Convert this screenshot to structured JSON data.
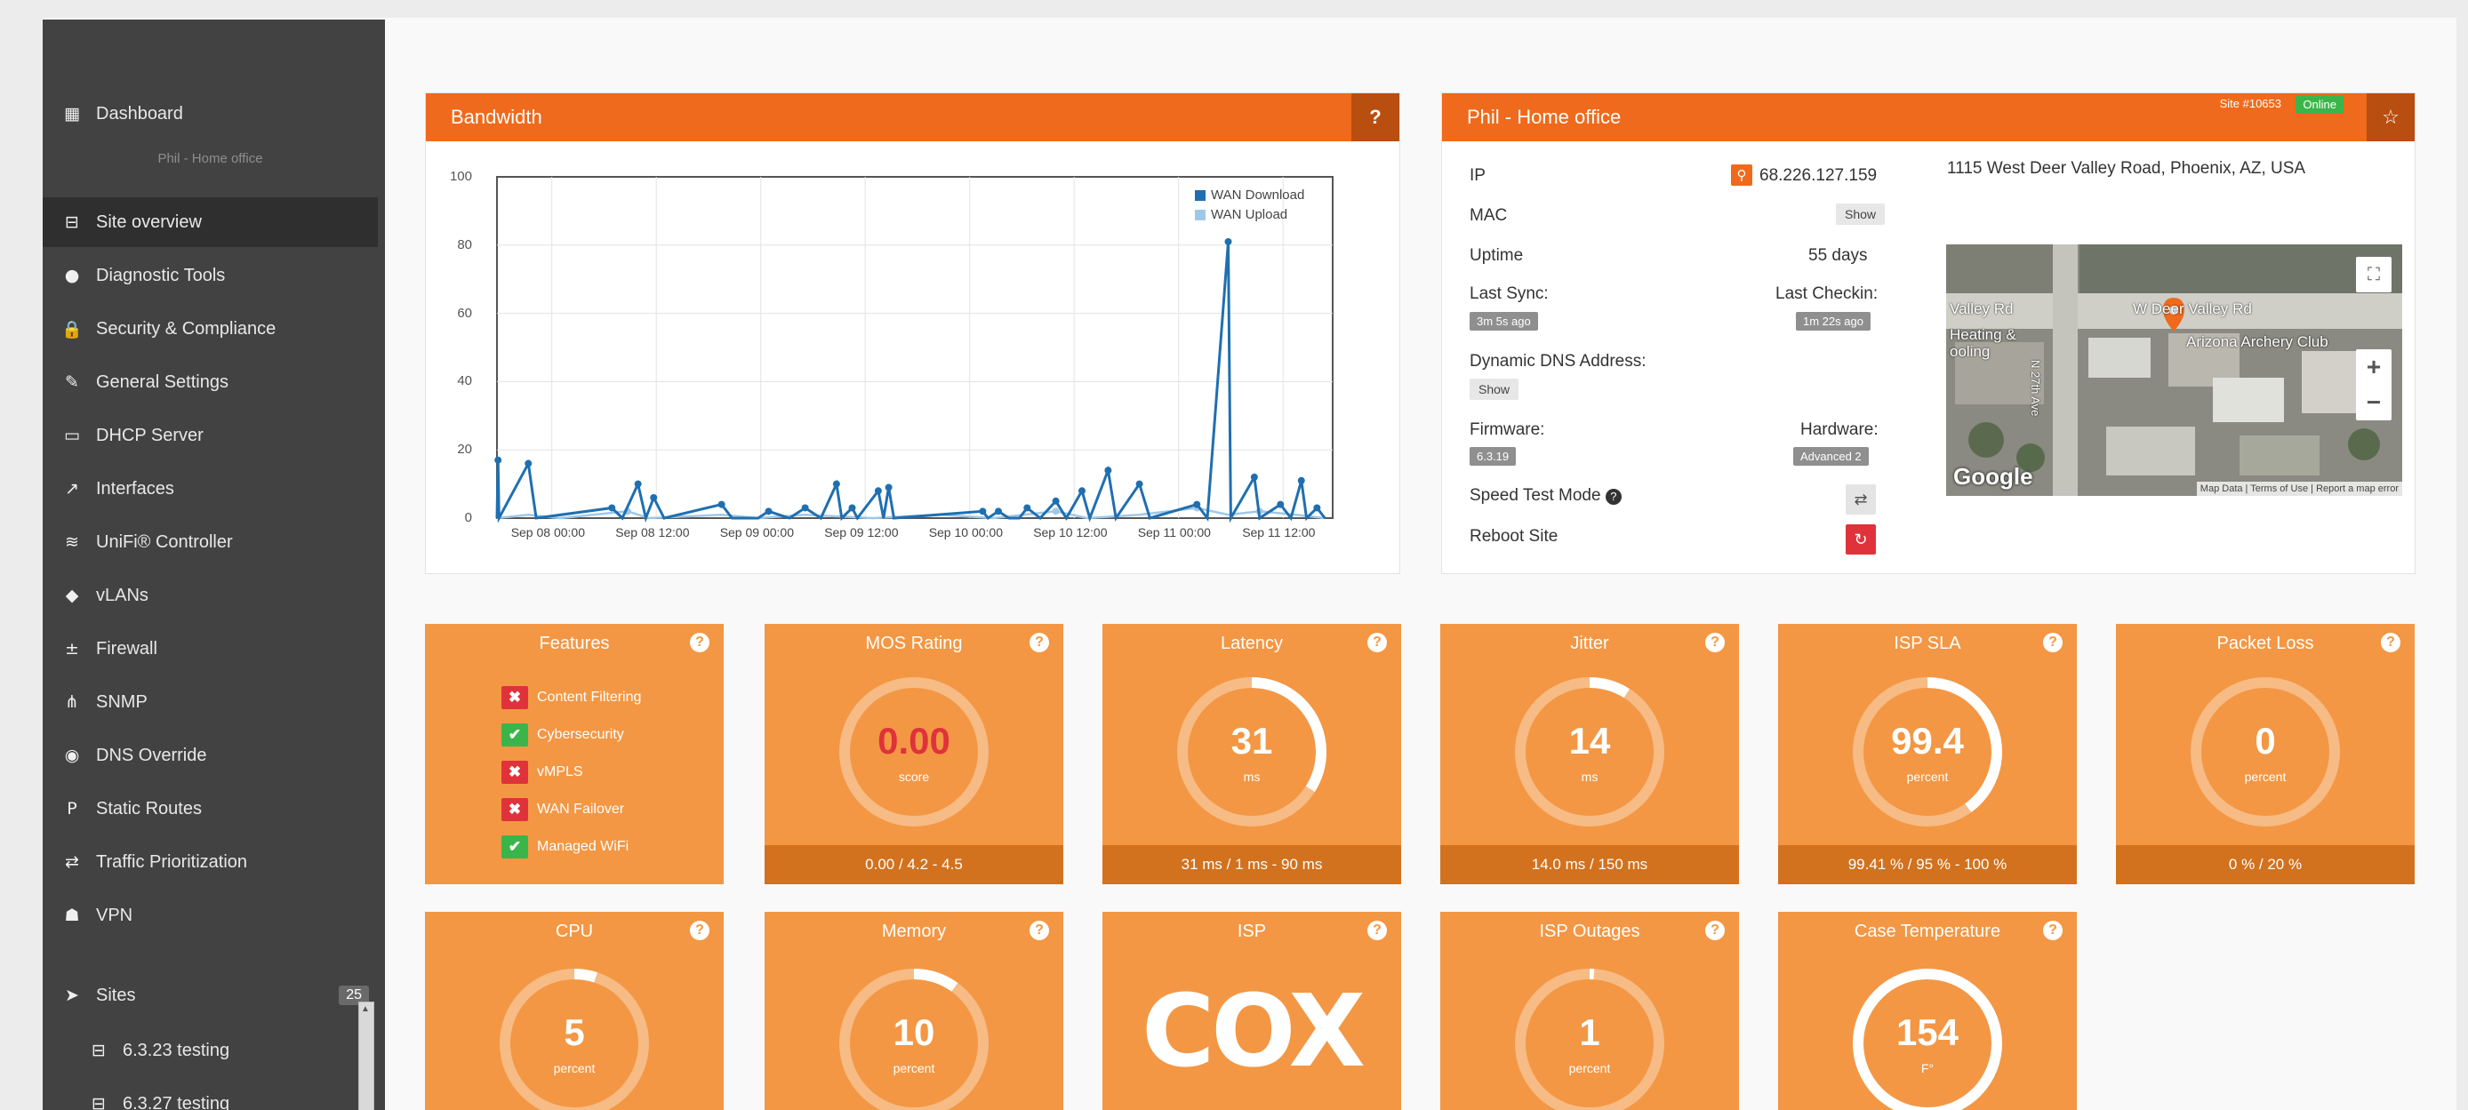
{
  "sidebar": {
    "dashboard": "Dashboard",
    "site_caption": "Phil - Home office",
    "items": [
      {
        "label": "Site overview",
        "icon": "site-overview-icon",
        "glyph": "⊟"
      },
      {
        "label": "Diagnostic Tools",
        "icon": "info-icon",
        "glyph": "●"
      },
      {
        "label": "Security & Compliance",
        "icon": "lock-icon",
        "glyph": "🔒"
      },
      {
        "label": "General Settings",
        "icon": "wrench-icon",
        "glyph": "✎"
      },
      {
        "label": "DHCP Server",
        "icon": "monitor-icon",
        "glyph": "▭"
      },
      {
        "label": "Interfaces",
        "icon": "external-link-icon",
        "glyph": "↗"
      },
      {
        "label": "UniFi® Controller",
        "icon": "antenna-icon",
        "glyph": "≋"
      },
      {
        "label": "vLANs",
        "icon": "tag-icon",
        "glyph": "◆"
      },
      {
        "label": "Firewall",
        "icon": "firewall-icon",
        "glyph": "±"
      },
      {
        "label": "SNMP",
        "icon": "sitemap-icon",
        "glyph": "⋔"
      },
      {
        "label": "DNS Override",
        "icon": "dns-icon",
        "glyph": "◉"
      },
      {
        "label": "Static Routes",
        "icon": "route-icon",
        "glyph": "P"
      },
      {
        "label": "Traffic Prioritization",
        "icon": "exchange-icon",
        "glyph": "⇄"
      },
      {
        "label": "VPN",
        "icon": "users-icon",
        "glyph": "☗"
      }
    ],
    "sites_label": "Sites",
    "sites_count": "25",
    "sites": [
      "6.3.23 testing",
      "6.3.27 testing"
    ]
  },
  "bandwidth": {
    "title": "Bandwidth",
    "help": "?",
    "legend": [
      {
        "label": "WAN Download",
        "color": "#1f6fb0"
      },
      {
        "label": "WAN Upload",
        "color": "#9fc8e8"
      }
    ]
  },
  "chart_data": {
    "type": "line",
    "ylim": [
      0,
      100
    ],
    "yticks": [
      "100",
      "80",
      "60",
      "40",
      "20",
      "0"
    ],
    "categories": [
      "Sep 08 00:00",
      "Sep 08 12:00",
      "Sep 09 00:00",
      "Sep 09 12:00",
      "Sep 10 00:00",
      "Sep 10 12:00",
      "Sep 11 00:00",
      "Sep 11 12:00"
    ],
    "series": [
      {
        "name": "WAN Download",
        "color": "#1f6fb0",
        "points": [
          [
            0,
            0
          ],
          [
            0.02,
            17
          ],
          [
            0.04,
            0
          ],
          [
            0.6,
            16
          ],
          [
            0.75,
            0
          ],
          [
            2.2,
            3
          ],
          [
            2.4,
            0
          ],
          [
            2.7,
            10
          ],
          [
            2.85,
            0
          ],
          [
            3.0,
            6
          ],
          [
            3.2,
            0
          ],
          [
            4.3,
            4
          ],
          [
            4.5,
            0
          ],
          [
            5.0,
            0
          ],
          [
            5.2,
            2
          ],
          [
            5.6,
            0
          ],
          [
            5.9,
            3
          ],
          [
            6.2,
            0
          ],
          [
            6.5,
            10
          ],
          [
            6.6,
            0
          ],
          [
            6.8,
            3
          ],
          [
            6.9,
            0
          ],
          [
            7.3,
            8
          ],
          [
            7.4,
            0
          ],
          [
            7.5,
            9
          ],
          [
            7.6,
            0
          ],
          [
            9.3,
            2
          ],
          [
            9.4,
            0
          ],
          [
            9.6,
            2
          ],
          [
            9.8,
            0
          ],
          [
            10.0,
            0
          ],
          [
            10.15,
            3
          ],
          [
            10.4,
            0
          ],
          [
            10.7,
            5
          ],
          [
            10.9,
            0
          ],
          [
            11.2,
            8
          ],
          [
            11.35,
            0
          ],
          [
            11.7,
            14
          ],
          [
            11.85,
            0
          ],
          [
            12.3,
            10
          ],
          [
            12.5,
            0
          ],
          [
            13.4,
            4
          ],
          [
            13.6,
            0
          ],
          [
            14.0,
            81
          ],
          [
            14.05,
            0
          ],
          [
            14.5,
            12
          ],
          [
            14.6,
            0
          ],
          [
            15.0,
            4
          ],
          [
            15.2,
            0
          ],
          [
            15.4,
            11
          ],
          [
            15.5,
            0
          ],
          [
            15.7,
            3
          ],
          [
            15.85,
            0
          ]
        ]
      },
      {
        "name": "WAN Upload",
        "color": "#9fc8e8",
        "points": [
          [
            0,
            0
          ],
          [
            0.6,
            1
          ],
          [
            1.2,
            0
          ],
          [
            2.5,
            2
          ],
          [
            2.9,
            0
          ],
          [
            4.3,
            1
          ],
          [
            5.0,
            0
          ],
          [
            5.9,
            1
          ],
          [
            7.2,
            0
          ],
          [
            8.5,
            1
          ],
          [
            9.5,
            0
          ],
          [
            10.7,
            2
          ],
          [
            11.3,
            0
          ],
          [
            12.3,
            1
          ],
          [
            13.4,
            3
          ],
          [
            14.0,
            1
          ],
          [
            14.6,
            2
          ],
          [
            15.3,
            1
          ],
          [
            15.85,
            0
          ]
        ]
      }
    ]
  },
  "site": {
    "title": "Phil - Home office",
    "site_id": "Site #10653",
    "status": "Online",
    "ip_label": "IP",
    "ip_value": "68.226.127.159",
    "mac_label": "MAC",
    "mac_btn": "Show",
    "uptime_label": "Uptime",
    "uptime_value": "55 days",
    "last_sync_label": "Last Sync:",
    "last_sync_value": "3m 5s ago",
    "last_checkin_label": "Last Checkin:",
    "last_checkin_value": "1m 22s ago",
    "ddns_label": "Dynamic DNS Address:",
    "ddns_btn": "Show",
    "firmware_label": "Firmware:",
    "firmware_value": "6.3.19",
    "hardware_label": "Hardware:",
    "hardware_value": "Advanced 2",
    "speedtest_label": "Speed Test Mode",
    "reboot_label": "Reboot Site",
    "address": "1115 West Deer Valley Road, Phoenix, AZ, USA",
    "map": {
      "road_label": "W Deer Valley Rd",
      "road_label_left": "Valley Rd",
      "business_label": "Arizona Archery Club",
      "heating_label": "Heating &",
      "heating_label2": "ooling",
      "street_label": "N 27th Ave",
      "google": "Google",
      "attrib1": "Map Data",
      "attrib2": "Terms of Use",
      "attrib3": "Report a map error",
      "zoom_in": "+",
      "zoom_out": "−"
    }
  },
  "tiles": [
    {
      "title": "Features",
      "features": [
        {
          "label": "Content Filtering",
          "enabled": false
        },
        {
          "label": "Cybersecurity",
          "enabled": true
        },
        {
          "label": "vMPLS",
          "enabled": false
        },
        {
          "label": "WAN Failover",
          "enabled": false
        },
        {
          "label": "Managed WiFi",
          "enabled": true
        }
      ]
    },
    {
      "title": "MOS Rating",
      "value": "0.00",
      "unit": "score",
      "footer": "0.00 / 4.2 - 4.5",
      "fraction": 0.0,
      "value_color": "#e0323a"
    },
    {
      "title": "Latency",
      "value": "31",
      "unit": "ms",
      "footer": "31 ms / 1 ms - 90 ms",
      "fraction": 0.34
    },
    {
      "title": "Jitter",
      "value": "14",
      "unit": "ms",
      "footer": "14.0 ms / 150 ms",
      "fraction": 0.09
    },
    {
      "title": "ISP SLA",
      "value": "99.4",
      "unit": "percent",
      "footer": "99.41 % / 95 % - 100 %",
      "fraction": 0.4
    },
    {
      "title": "Packet Loss",
      "value": "0",
      "unit": "percent",
      "footer": "0 % / 20 %",
      "fraction": 0.0
    },
    {
      "title": "CPU",
      "value": "5",
      "unit": "percent",
      "fraction": 0.05
    },
    {
      "title": "Memory",
      "value": "10",
      "unit": "percent",
      "fraction": 0.1
    },
    {
      "title": "ISP",
      "logo": "COX"
    },
    {
      "title": "ISP Outages",
      "value": "1",
      "unit": "percent",
      "fraction": 0.01
    },
    {
      "title": "Case Temperature",
      "value": "154",
      "unit": "F°",
      "fraction": 1.0
    }
  ],
  "colors": {
    "orange_header": "#ef6a1c",
    "tile": "#f39744",
    "tile_footer": "#d2721e",
    "sidebar": "#424242",
    "green": "#3bb54a",
    "red": "#e0323a"
  }
}
